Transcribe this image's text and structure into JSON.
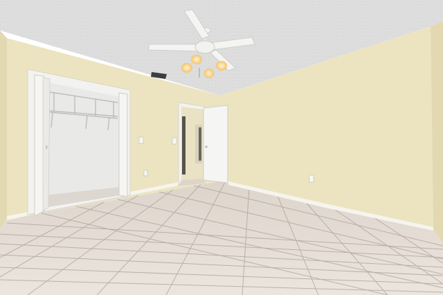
{
  "scene": {
    "ceiling_color": "#dcdcdc",
    "wall_color": "#ece4c0",
    "wall_shadow_color": "#e2d9b2",
    "floor_color": "#e6ded6",
    "grout_color": "#a9a099",
    "baseboard_color": "#f6f4ee",
    "trim_color": "#f3f2ee",
    "closet_interior_color": "#e9e9e8",
    "door_color": "#f5f5f3",
    "fan_body_color": "#f4f4f2",
    "fan_light_color": "#f7dca0"
  }
}
